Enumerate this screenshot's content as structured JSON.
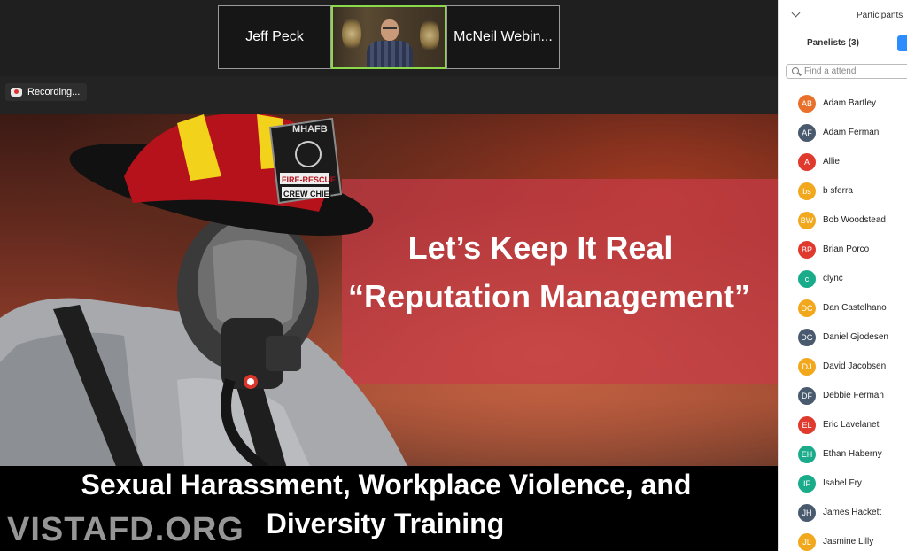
{
  "thumbnails": [
    {
      "label": "Jeff Peck",
      "type": "name"
    },
    {
      "label": "",
      "type": "video"
    },
    {
      "label": "McNeil Webin...",
      "type": "name"
    }
  ],
  "recording_label": "Recording...",
  "slide": {
    "headline_line1": "Let’s Keep It Real",
    "headline_line2": "“Reputation Management”",
    "footer_line1": "Sexual Harassment, Workplace Violence, and",
    "footer_line2": "Diversity Training",
    "watermark": "VISTAFD.ORG",
    "helmet_badge_top": "MHAFB",
    "helmet_badge_mid": "FIRE-RESCUE",
    "helmet_badge_bottom": "CREW CHIEF"
  },
  "panel": {
    "title": "Participants",
    "tab_panelists": "Panelists (3)",
    "search_placeholder": "Find a attend",
    "participants": [
      {
        "initials": "AB",
        "name": "Adam Bartley",
        "color": "#e8702a"
      },
      {
        "initials": "AF",
        "name": "Adam Ferman",
        "color": "#4a5a6e"
      },
      {
        "initials": "A",
        "name": "Allie",
        "color": "#e03a2e"
      },
      {
        "initials": "bs",
        "name": "b sferra",
        "color": "#f2a81d"
      },
      {
        "initials": "BW",
        "name": "Bob Woodstead",
        "color": "#f2a81d"
      },
      {
        "initials": "BP",
        "name": "Brian Porco",
        "color": "#e03a2e"
      },
      {
        "initials": "c",
        "name": "clync",
        "color": "#1aab8a"
      },
      {
        "initials": "DC",
        "name": "Dan Castelhano",
        "color": "#f2a81d"
      },
      {
        "initials": "DG",
        "name": "Daniel Gjodesen",
        "color": "#4a5a6e"
      },
      {
        "initials": "DJ",
        "name": "David Jacobsen",
        "color": "#f2a81d"
      },
      {
        "initials": "DF",
        "name": "Debbie Ferman",
        "color": "#4a5a6e"
      },
      {
        "initials": "EL",
        "name": "Eric Lavelanet",
        "color": "#e03a2e"
      },
      {
        "initials": "EH",
        "name": "Ethan Haberny",
        "color": "#1aab8a"
      },
      {
        "initials": "IF",
        "name": "Isabel Fry",
        "color": "#1aab8a"
      },
      {
        "initials": "JH",
        "name": "James Hackett",
        "color": "#4a5a6e"
      },
      {
        "initials": "JL",
        "name": "Jasmine Lilly",
        "color": "#f2a81d"
      }
    ]
  }
}
